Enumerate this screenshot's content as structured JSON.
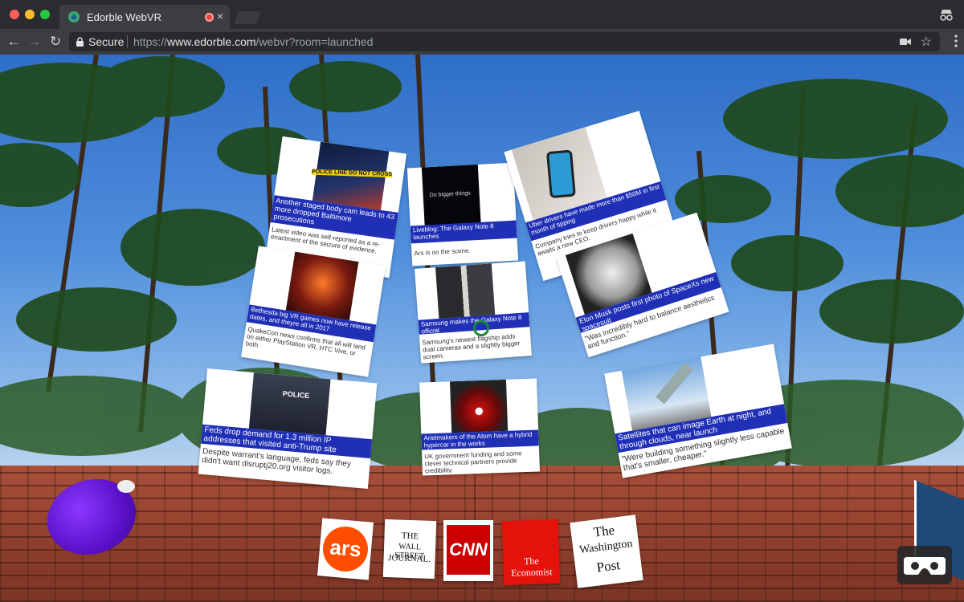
{
  "window": {
    "tab_title": "Edorble WebVR",
    "tab_close": "×"
  },
  "toolbar": {
    "back": "←",
    "forward": "→",
    "reload": "↻",
    "secure_label": "Secure",
    "url_scheme": "https://",
    "url_host": "www.edorble.com",
    "url_path": "/webvr?room=launched",
    "star": "☆"
  },
  "articles": [
    {
      "headline": "Another staged body cam leads to 43 more dropped Baltimore prosecutions",
      "summary": "Latest video was self-reported as a re-enactment of the seizure of evidence."
    },
    {
      "headline": "Liveblog: The Galaxy Note 8 launches",
      "summary": "Ars is on the scene.",
      "image_text": "Do bigger things"
    },
    {
      "headline": "Uber drivers have made more than $50M in first month of tipping",
      "summary": "Company tries to keep drivers happy while it awaits a new CEO."
    },
    {
      "headline": "Bethesda big VR games now have release dates, and theyre all in 2017",
      "summary": "QuakeCon news confirms that all will land on either PlayStation VR, HTC Vive, or both."
    },
    {
      "headline": "Samsung makes the Galaxy Note 8 official",
      "summary": "Samsung's newest flagship adds dual cameras and a slightly bigger screen."
    },
    {
      "headline": "Elon Musk posts first photo of SpaceXs new spacesuit",
      "summary": "\"Was incredibly hard to balance aesthetics and function.\""
    },
    {
      "headline": "Feds drop demand for 1.3 million IP addresses that visited anti-Trump site",
      "summary": "Despite warrant's language, feds say they didn't want disruptj20.org visitor logs.",
      "image_text": "POLICE"
    },
    {
      "headline": "Arielmakers of the Atom have a hybrid hypercar in the works",
      "summary": "UK government funding and some clever technical partners provide credibility."
    },
    {
      "headline": "Satellites that can image Earth at night, and through clouds, near launch",
      "summary": "\"Were building something slightly less capable that's smaller, cheaper.\""
    }
  ],
  "police_tape": "POLICE LINE DO NOT CROSS",
  "publishers": [
    {
      "name": "ars",
      "color": "#ff4e00"
    },
    {
      "name_line1": "THE",
      "name_line2": "WALL STREET",
      "name_line3": "JOURNAL."
    },
    {
      "name": "CNN",
      "color": "#cc0000"
    },
    {
      "name_line1": "The",
      "name_line2": "Economist",
      "color": "#e3120b"
    },
    {
      "name_line1": "The",
      "name_line2": "Washington",
      "name_line3": "Post"
    }
  ],
  "colors": {
    "headline_band": "#1f2fb6",
    "gaze_cursor": "#1a8a34",
    "orb": "#6a1fe0"
  }
}
